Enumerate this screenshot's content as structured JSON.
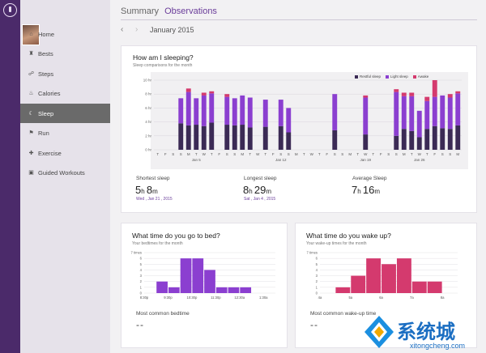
{
  "header": {
    "section": "Summary",
    "active": "Observations"
  },
  "datebar": {
    "prev_icon": "chevron-left-icon",
    "next_icon": "chevron-right-icon",
    "label": "January 2015"
  },
  "nav": {
    "items": [
      {
        "label": "Home",
        "icon": "home-icon"
      },
      {
        "label": "Bests",
        "icon": "trophy-icon"
      },
      {
        "label": "Steps",
        "icon": "steps-icon"
      },
      {
        "label": "Calories",
        "icon": "flame-icon"
      },
      {
        "label": "Sleep",
        "icon": "moon-icon",
        "active": true
      },
      {
        "label": "Run",
        "icon": "run-icon"
      },
      {
        "label": "Exercise",
        "icon": "exercise-icon"
      },
      {
        "label": "Guided Workouts",
        "icon": "workout-icon"
      }
    ]
  },
  "sleep": {
    "title": "How am I sleeping?",
    "subtitle": "Sleep comparisons for the month",
    "legend": [
      "Restful sleep",
      "Light sleep",
      "Awake"
    ],
    "shortest": {
      "label": "Shortest sleep",
      "h": "5",
      "m": "8",
      "date": "Wed , Jan 21 , 2015"
    },
    "longest": {
      "label": "Longest sleep",
      "h": "8",
      "m": "29",
      "date": "Sat , Jan 4 , 2015"
    },
    "average": {
      "label": "Average Sleep",
      "h": "7",
      "m": "16"
    }
  },
  "bed": {
    "title": "What time do you go to bed?",
    "subtitle": "Your bedtimes for the month",
    "common_label": "Most common bedtime",
    "common_value": "--"
  },
  "wake": {
    "title": "What time do you wake up?",
    "subtitle": "Your wake-up times for the month",
    "common_label": "Most common wake-up time",
    "common_value": "--"
  },
  "watermark": {
    "brand": "系统城",
    "url": "xitongcheng.com"
  },
  "colors": {
    "restful": "#3b2a55",
    "light": "#8b3fd0",
    "awake": "#d43a6e",
    "purple": "#8b3fd0",
    "pink": "#d43a6e"
  },
  "chart_data": [
    {
      "type": "bar",
      "title": "How am I sleeping?",
      "ylabel": "",
      "yticks": [
        "0 hr",
        "2 hr",
        "4 hr",
        "6 hr",
        "8 hr",
        "10 hr"
      ],
      "ylim": [
        0,
        10
      ],
      "categories": [
        "T",
        "F",
        "S",
        "S",
        "M",
        "T",
        "W",
        "T",
        "F",
        "S",
        "S",
        "M",
        "T",
        "W",
        "T",
        "F",
        "S",
        "S",
        "M",
        "T",
        "W",
        "T",
        "F",
        "S",
        "S",
        "M",
        "T",
        "W",
        "T",
        "F",
        "S",
        "S",
        "M",
        "T",
        "W",
        "T",
        "F",
        "S",
        "S",
        "M"
      ],
      "date_labels": [
        {
          "index": 5,
          "label": "Jan 5"
        },
        {
          "index": 16,
          "label": "Jan 12"
        },
        {
          "index": 27,
          "label": "Jan 19"
        },
        {
          "index": 34,
          "label": "Jan 26"
        }
      ],
      "series": [
        {
          "name": "Restful sleep",
          "values": [
            0,
            0,
            0,
            3.8,
            3.5,
            3.6,
            3.4,
            3.9,
            0,
            3.6,
            3.5,
            3.6,
            3.2,
            0,
            3.3,
            0,
            3.4,
            2.5,
            0,
            0,
            0,
            0,
            0,
            2.8,
            0,
            0,
            0,
            2.2,
            0,
            0,
            0,
            2.0,
            3.0,
            2.7,
            1.8,
            3.0,
            3.4,
            3.1,
            3.0,
            3.5
          ]
        },
        {
          "name": "Light sleep",
          "values": [
            0,
            0,
            0,
            3.6,
            4.8,
            3.8,
            4.4,
            4.2,
            0,
            4.0,
            3.9,
            4.2,
            4.3,
            0,
            3.9,
            0,
            3.8,
            3.5,
            0,
            0,
            0,
            0,
            0,
            5.2,
            0,
            0,
            0,
            5.3,
            0,
            0,
            0,
            6.3,
            4.7,
            5.0,
            3.8,
            4.0,
            4.2,
            4.7,
            4.5,
            4.6
          ]
        },
        {
          "name": "Awake",
          "values": [
            0,
            0,
            0,
            0,
            0.5,
            0,
            0.4,
            0.3,
            0,
            0.4,
            0,
            0,
            0,
            0,
            0,
            0,
            0,
            0,
            0,
            0,
            0,
            0,
            0,
            0,
            0,
            0,
            0,
            0.3,
            0,
            0,
            0,
            0.4,
            0.5,
            0.5,
            0,
            0.6,
            2.4,
            0,
            0.5,
            0.3
          ]
        }
      ],
      "totals": [
        0,
        0,
        0,
        7.5,
        8.8,
        7.8,
        8.1,
        8.4,
        0,
        8.0,
        7.5,
        7.8,
        7.7,
        0,
        7.2,
        0,
        7.2,
        6.0,
        0,
        0,
        0,
        0,
        0,
        8.0,
        0,
        0,
        0,
        7.8,
        0,
        0,
        0,
        8.7,
        8.1,
        8.2,
        5.6,
        7.7,
        10.0,
        7.8,
        8.0,
        8.4
      ]
    },
    {
      "type": "bar",
      "title": "What time do you go to bed?",
      "yticks": [
        "0",
        "1",
        "2",
        "3",
        "4",
        "5",
        "6",
        "7 times"
      ],
      "ylim": [
        0,
        7
      ],
      "categories": [
        "8:30p",
        "9:00p",
        "9:30p",
        "10:00p",
        "10:30p",
        "11:00p",
        "11:30p",
        "12:00a",
        "12:30a",
        "1:00a",
        "1:30a"
      ],
      "x_tick_labels": [
        "8:30p",
        "9:30p",
        "10:30p",
        "11:30p",
        "12:30a",
        "1:30a"
      ],
      "values": [
        0,
        2,
        1,
        6,
        6,
        4,
        1,
        1,
        1,
        0,
        0
      ]
    },
    {
      "type": "bar",
      "title": "What time do you wake up?",
      "yticks": [
        "0",
        "1",
        "2",
        "3",
        "4",
        "5",
        "6",
        "7 times"
      ],
      "ylim": [
        0,
        7
      ],
      "categories": [
        "4a",
        "4:30a",
        "5a",
        "5:30a",
        "6a",
        "6:30a",
        "7a",
        "7:30a",
        "8a"
      ],
      "x_tick_labels": [
        "4a",
        "5a",
        "6a",
        "7a",
        "8a"
      ],
      "values": [
        0,
        1,
        3,
        6,
        5,
        6,
        2,
        2,
        0
      ]
    }
  ]
}
